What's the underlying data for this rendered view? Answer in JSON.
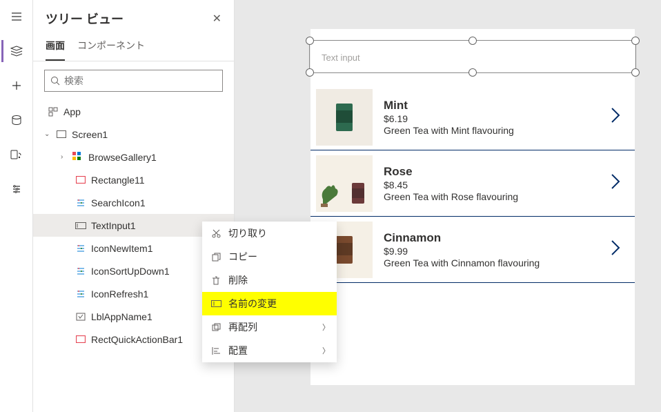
{
  "panel": {
    "title": "ツリー ビュー",
    "tabs": {
      "screens": "画面",
      "components": "コンポーネント"
    },
    "search_placeholder": "検索"
  },
  "tree": {
    "app": "App",
    "screen": "Screen1",
    "items": [
      {
        "name": "BrowseGallery1"
      },
      {
        "name": "Rectangle11"
      },
      {
        "name": "SearchIcon1"
      },
      {
        "name": "TextInput1"
      },
      {
        "name": "IconNewItem1"
      },
      {
        "name": "IconSortUpDown1"
      },
      {
        "name": "IconRefresh1"
      },
      {
        "name": "LblAppName1"
      },
      {
        "name": "RectQuickActionBar1"
      }
    ]
  },
  "context_menu": {
    "cut": "切り取り",
    "copy": "コピー",
    "delete": "削除",
    "rename": "名前の変更",
    "reorder": "再配列",
    "align": "配置"
  },
  "text_input_placeholder": "Text input",
  "gallery": [
    {
      "name": "Mint",
      "price": "$6.19",
      "desc": "Green Tea with Mint flavouring",
      "thumb_bg": "#f0ebe3",
      "can_color": "#2d6a4f"
    },
    {
      "name": "Rose",
      "price": "$8.45",
      "desc": "Green Tea with Rose flavouring",
      "thumb_bg": "#f5f0e6",
      "can_color": "#6b3a3a"
    },
    {
      "name": "Cinnamon",
      "price": "$9.99",
      "desc": "Green Tea with Cinnamon flavouring",
      "thumb_bg": "#f5f0e6",
      "can_color": "#7a4a2e"
    }
  ]
}
